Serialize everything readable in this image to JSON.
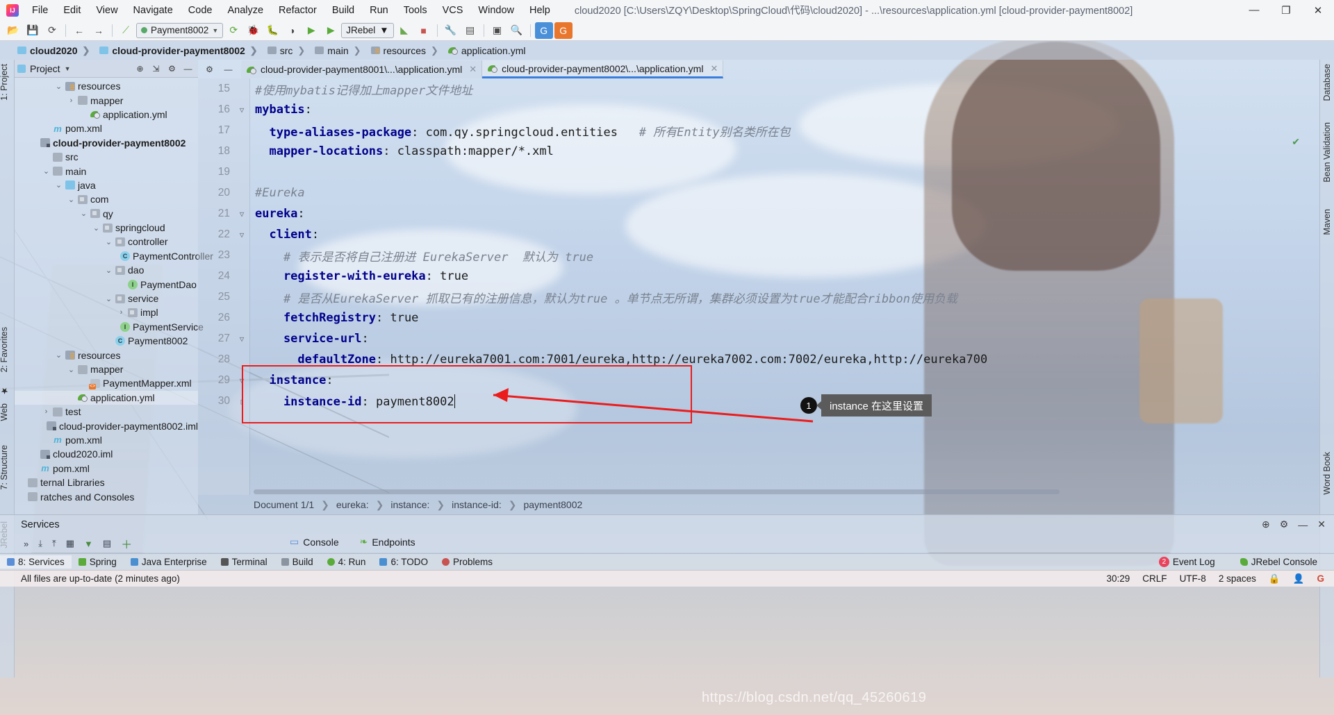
{
  "window": {
    "title": "cloud2020 [C:\\Users\\ZQY\\Desktop\\SpringCloud\\代码\\cloud2020] - ...\\resources\\application.yml [cloud-provider-payment8002]",
    "minimize": "—",
    "maximize": "❐",
    "close": "✕"
  },
  "menu": {
    "items": [
      "File",
      "Edit",
      "View",
      "Navigate",
      "Code",
      "Analyze",
      "Refactor",
      "Build",
      "Run",
      "Tools",
      "VCS",
      "Window",
      "Help"
    ]
  },
  "toolbar": {
    "run_config": "Payment8002",
    "jrebel": "JRebel",
    "icons": [
      "open-icon",
      "save-icon",
      "sync-icon",
      "back-icon",
      "forward-icon",
      "search-everywhere-icon",
      "build-icon",
      "ant-icon",
      "debug-icon",
      "coverage-icon",
      "jrebel-run-icon",
      "jrebel-debug-icon",
      "profile-icon",
      "stop-icon",
      "settings-wrench-icon",
      "structure-icon",
      "preview-icon",
      "search-icon",
      "translate-icon",
      "translate2-icon"
    ]
  },
  "breadcrumb": {
    "items": [
      {
        "label": "cloud2020",
        "icon": "module-icon",
        "bold": true
      },
      {
        "label": "cloud-provider-payment8002",
        "icon": "module-icon",
        "bold": true
      },
      {
        "label": "src",
        "icon": "folder-icon",
        "bold": false
      },
      {
        "label": "main",
        "icon": "folder-icon",
        "bold": false
      },
      {
        "label": "resources",
        "icon": "resources-folder-icon",
        "bold": false
      },
      {
        "label": "application.yml",
        "icon": "yml-icon",
        "bold": false
      }
    ]
  },
  "left_strips": [
    {
      "label": "1: Project"
    },
    {
      "label": "2: Favorites"
    },
    {
      "label": "Web"
    },
    {
      "label": "7: Structure"
    },
    {
      "label": "JRebel"
    }
  ],
  "right_strips": [
    {
      "label": "Database"
    },
    {
      "label": "Bean Validation"
    },
    {
      "label": "Maven"
    },
    {
      "label": "Word Book"
    }
  ],
  "project_panel": {
    "title": "Project",
    "tools": [
      "locate-icon",
      "collapse-all-icon",
      "gear-icon",
      "hide-icon"
    ],
    "tree": [
      {
        "indent": 3,
        "twisty": "v",
        "icon": "folder-resources",
        "label": "resources",
        "bold": false,
        "selected": false
      },
      {
        "indent": 4,
        "twisty": ">",
        "icon": "folder-grey",
        "label": "mapper",
        "bold": false,
        "selected": false
      },
      {
        "indent": 5,
        "twisty": "",
        "icon": "yml",
        "label": "application.yml",
        "bold": false,
        "selected": false
      },
      {
        "indent": 2,
        "twisty": "",
        "icon": "maven",
        "label": "pom.xml",
        "bold": false,
        "selected": false
      },
      {
        "indent": 1,
        "twisty": "",
        "icon": "module",
        "label": "cloud-provider-payment8002",
        "bold": true,
        "selected": false
      },
      {
        "indent": 2,
        "twisty": "",
        "icon": "folder-grey",
        "label": "src",
        "bold": false,
        "selected": false
      },
      {
        "indent": 2,
        "twisty": "v",
        "icon": "folder-grey",
        "label": "main",
        "bold": false,
        "selected": false
      },
      {
        "indent": 3,
        "twisty": "v",
        "icon": "folder-blue",
        "label": "java",
        "bold": false,
        "selected": false
      },
      {
        "indent": 4,
        "twisty": "v",
        "icon": "package",
        "label": "com",
        "bold": false,
        "selected": false
      },
      {
        "indent": 5,
        "twisty": "v",
        "icon": "package",
        "label": "qy",
        "bold": false,
        "selected": false
      },
      {
        "indent": 6,
        "twisty": "v",
        "icon": "package",
        "label": "springcloud",
        "bold": false,
        "selected": false
      },
      {
        "indent": 7,
        "twisty": "v",
        "icon": "package",
        "label": "controller",
        "bold": false,
        "selected": false
      },
      {
        "indent": 8,
        "twisty": "",
        "icon": "class",
        "label": "PaymentController",
        "bold": false,
        "selected": false
      },
      {
        "indent": 7,
        "twisty": "v",
        "icon": "package",
        "label": "dao",
        "bold": false,
        "selected": false
      },
      {
        "indent": 8,
        "twisty": "",
        "icon": "interface",
        "label": "PaymentDao",
        "bold": false,
        "selected": false
      },
      {
        "indent": 7,
        "twisty": "v",
        "icon": "package",
        "label": "service",
        "bold": false,
        "selected": false
      },
      {
        "indent": 8,
        "twisty": ">",
        "icon": "package",
        "label": "impl",
        "bold": false,
        "selected": false
      },
      {
        "indent": 8,
        "twisty": "",
        "icon": "interface",
        "label": "PaymentService",
        "bold": false,
        "selected": false
      },
      {
        "indent": 7,
        "twisty": "",
        "icon": "class-run",
        "label": "Payment8002",
        "bold": false,
        "selected": false
      },
      {
        "indent": 3,
        "twisty": "v",
        "icon": "folder-resources",
        "label": "resources",
        "bold": false,
        "selected": false
      },
      {
        "indent": 4,
        "twisty": "v",
        "icon": "folder-grey",
        "label": "mapper",
        "bold": false,
        "selected": false
      },
      {
        "indent": 5,
        "twisty": "",
        "icon": "xml",
        "label": "PaymentMapper.xml",
        "bold": false,
        "selected": false
      },
      {
        "indent": 4,
        "twisty": "",
        "icon": "yml",
        "label": "application.yml",
        "bold": false,
        "selected": true
      },
      {
        "indent": 2,
        "twisty": ">",
        "icon": "folder-grey",
        "label": "test",
        "bold": false,
        "selected": false
      },
      {
        "indent": 2,
        "twisty": "",
        "icon": "iml",
        "label": "cloud-provider-payment8002.iml",
        "bold": false,
        "selected": false
      },
      {
        "indent": 2,
        "twisty": "",
        "icon": "maven",
        "label": "pom.xml",
        "bold": false,
        "selected": false
      },
      {
        "indent": 1,
        "twisty": "",
        "icon": "iml",
        "label": "cloud2020.iml",
        "bold": false,
        "selected": false
      },
      {
        "indent": 1,
        "twisty": "",
        "icon": "maven",
        "label": "pom.xml",
        "bold": false,
        "selected": false
      },
      {
        "indent": 0,
        "twisty": "",
        "icon": "lib",
        "label": "ternal Libraries",
        "bold": false,
        "selected": false
      },
      {
        "indent": 0,
        "twisty": "",
        "icon": "scratch",
        "label": "ratches and Consoles",
        "bold": false,
        "selected": false
      }
    ]
  },
  "editor": {
    "tabs": [
      {
        "label": "cloud-provider-payment8001\\...\\application.yml",
        "active": false,
        "close": "✕"
      },
      {
        "label": "cloud-provider-payment8002\\...\\application.yml",
        "active": true,
        "close": "✕"
      }
    ],
    "tab_tools": [
      "gear-icon",
      "hide-icon"
    ],
    "lines": [
      {
        "num": "15",
        "fold": "",
        "segments": [
          {
            "cls": "k-cmt",
            "t": "#使用mybatis记得加上mapper文件地址"
          }
        ]
      },
      {
        "num": "16",
        "fold": "▽",
        "segments": [
          {
            "cls": "k-key",
            "t": "mybatis"
          },
          {
            "cls": "k-val",
            "t": ":"
          }
        ]
      },
      {
        "num": "17",
        "fold": "",
        "segments": [
          {
            "cls": "k-key",
            "t": "  type-aliases-package"
          },
          {
            "cls": "k-val",
            "t": ": com.qy.springcloud.entities   "
          },
          {
            "cls": "k-cmt",
            "t": "# 所有Entity别名类所在包"
          }
        ]
      },
      {
        "num": "18",
        "fold": "",
        "segments": [
          {
            "cls": "k-key",
            "t": "  mapper-locations"
          },
          {
            "cls": "k-val",
            "t": ": classpath:mapper/*.xml"
          }
        ]
      },
      {
        "num": "19",
        "fold": "",
        "segments": [
          {
            "cls": "k-val",
            "t": ""
          }
        ]
      },
      {
        "num": "20",
        "fold": "",
        "segments": [
          {
            "cls": "k-cmt",
            "t": "#Eureka"
          }
        ]
      },
      {
        "num": "21",
        "fold": "▽",
        "segments": [
          {
            "cls": "k-key",
            "t": "eureka"
          },
          {
            "cls": "k-val",
            "t": ":"
          }
        ]
      },
      {
        "num": "22",
        "fold": "▽",
        "segments": [
          {
            "cls": "k-key",
            "t": "  client"
          },
          {
            "cls": "k-val",
            "t": ":"
          }
        ]
      },
      {
        "num": "23",
        "fold": "",
        "segments": [
          {
            "cls": "k-cmt",
            "t": "    # 表示是否将自己注册进 EurekaServer  默认为 true"
          }
        ]
      },
      {
        "num": "24",
        "fold": "",
        "segments": [
          {
            "cls": "k-key",
            "t": "    register-with-eureka"
          },
          {
            "cls": "k-val",
            "t": ": true"
          }
        ]
      },
      {
        "num": "25",
        "fold": "",
        "segments": [
          {
            "cls": "k-cmt",
            "t": "    # 是否从EurekaServer 抓取已有的注册信息，默认为true 。单节点无所谓，集群必须设置为true才能配合ribbon使用负载"
          }
        ]
      },
      {
        "num": "26",
        "fold": "",
        "segments": [
          {
            "cls": "k-key",
            "t": "    fetchRegistry"
          },
          {
            "cls": "k-val",
            "t": ": true"
          }
        ]
      },
      {
        "num": "27",
        "fold": "▽",
        "segments": [
          {
            "cls": "k-key",
            "t": "    service-url"
          },
          {
            "cls": "k-val",
            "t": ":"
          }
        ]
      },
      {
        "num": "28",
        "fold": "",
        "segments": [
          {
            "cls": "k-key",
            "t": "      defaultZone"
          },
          {
            "cls": "k-val",
            "t": ": http://eureka7001.com:7001/eureka,http://eureka7002.com:7002/eureka,http://eureka700"
          }
        ]
      },
      {
        "num": "29",
        "fold": "▽",
        "segments": [
          {
            "cls": "k-key",
            "t": "  instance"
          },
          {
            "cls": "k-val",
            "t": ":"
          }
        ]
      },
      {
        "num": "30",
        "fold": "▯",
        "segments": [
          {
            "cls": "k-key",
            "t": "    instance-id"
          },
          {
            "cls": "k-val",
            "t": ": payment8002"
          }
        ],
        "caret": true
      }
    ],
    "annotation": {
      "badge": "1",
      "text": "instance 在这里设置",
      "box_color": "#ea1c1c"
    },
    "crumbs": [
      "Document 1/1",
      "eureka:",
      "instance:",
      "instance-id:",
      "payment8002"
    ]
  },
  "services": {
    "title": "Services",
    "right_icons": [
      "settings-target-icon",
      "gear-icon",
      "minimize-icon",
      "close-icon"
    ],
    "tool_icons": [
      "expand-icon",
      "collapse-icon",
      "group-icon",
      "filter-icon",
      "layout-icon",
      "add-icon"
    ],
    "tabs": [
      {
        "label": "Console",
        "icon": "console-icon"
      },
      {
        "label": "Endpoints",
        "icon": "endpoints-icon"
      }
    ]
  },
  "bottom_bar": {
    "left_items": [
      {
        "label": "8: Services",
        "icon": "services-icon",
        "active": true
      },
      {
        "label": "Spring",
        "icon": "spring-icon",
        "active": false
      },
      {
        "label": "Java Enterprise",
        "icon": "jee-icon",
        "active": false
      },
      {
        "label": "Terminal",
        "icon": "terminal-icon",
        "active": false
      },
      {
        "label": "Build",
        "icon": "build-icon",
        "active": false
      },
      {
        "label": "4: Run",
        "icon": "run-icon",
        "active": false
      },
      {
        "label": "6: TODO",
        "icon": "todo-icon",
        "active": false
      },
      {
        "label": "Problems",
        "icon": "problems-icon",
        "active": false
      }
    ],
    "right_items": [
      {
        "label": "Event Log",
        "icon": "event-log-icon",
        "badge": "2"
      },
      {
        "label": "JRebel Console",
        "icon": "jrebel-icon",
        "badge": ""
      }
    ]
  },
  "status_bar": {
    "message": "All files are up-to-date (2 minutes ago)",
    "position": "30:29",
    "line_separator": "CRLF",
    "encoding": "UTF-8",
    "indent": "2 spaces",
    "icons": [
      "lock-icon",
      "inspection-icon",
      "google-icon"
    ]
  },
  "watermark": "https://blog.csdn.net/qq_45260619"
}
